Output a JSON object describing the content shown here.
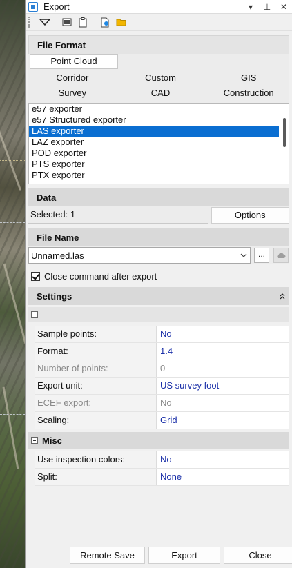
{
  "window": {
    "title": "Export"
  },
  "titlebar_buttons": {
    "menu": "▾",
    "pin": "⊥",
    "close": "✕"
  },
  "toolbar": {
    "icons": [
      "filter-dropdown-icon",
      "image-icon",
      "clipboard-icon",
      "new-file-icon",
      "folder-icon"
    ]
  },
  "file_format": {
    "header": "File Format",
    "active_tab": "Point Cloud",
    "tabs_row1": [
      "Corridor",
      "Custom",
      "GIS"
    ],
    "tabs_row2": [
      "Survey",
      "CAD",
      "Construction"
    ],
    "exporters": [
      "e57 exporter",
      "e57 Structured exporter",
      "LAS exporter",
      "LAZ exporter",
      "POD exporter",
      "PTS exporter",
      "PTX exporter"
    ],
    "selected_exporter": "LAS exporter"
  },
  "data": {
    "header": "Data",
    "selected_text": "Selected: 1",
    "options_label": "Options"
  },
  "file_name": {
    "header": "File Name",
    "value": "Unnamed.las",
    "browse_label": "..."
  },
  "close_after_export": {
    "label": "Close command after export",
    "checked": true
  },
  "settings": {
    "header": "Settings",
    "properties": [
      {
        "name": "Sample points:",
        "value": "No",
        "disabled": false
      },
      {
        "name": "Format:",
        "value": "1.4",
        "disabled": false
      },
      {
        "name": "Number of points:",
        "value": "0",
        "disabled": true
      },
      {
        "name": "Export unit:",
        "value": "US survey foot",
        "disabled": false
      },
      {
        "name": "ECEF export:",
        "value": "No",
        "disabled": true
      },
      {
        "name": "Scaling:",
        "value": "Grid",
        "disabled": false
      }
    ],
    "misc_header": "Misc",
    "misc_properties": [
      {
        "name": "Use inspection colors:",
        "value": "No",
        "disabled": false
      },
      {
        "name": "Split:",
        "value": "None",
        "disabled": false
      }
    ]
  },
  "footer": {
    "remote_save": "Remote Save",
    "export": "Export",
    "close": "Close"
  },
  "colors": {
    "selection": "#0a6ed1",
    "value_text": "#1a2fa8",
    "section_header": "#d9d9d9"
  }
}
